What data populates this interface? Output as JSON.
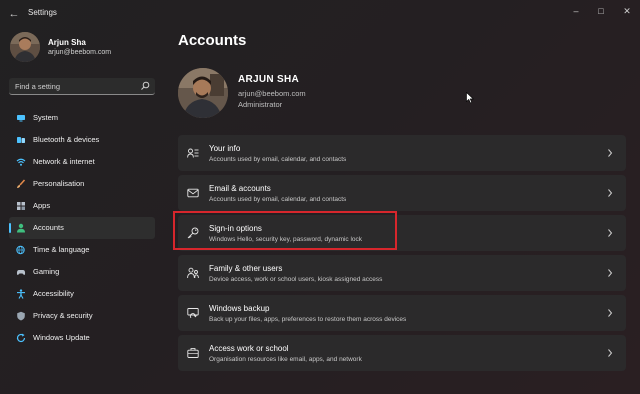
{
  "window": {
    "title": "Settings",
    "back_icon": "back-arrow-icon",
    "controls": [
      "minimize-icon",
      "maximize-icon",
      "close-icon"
    ]
  },
  "sidebar": {
    "profile": {
      "name": "Arjun Sha",
      "email": "arjun@beebom.com"
    },
    "search": {
      "placeholder": "Find a setting",
      "icon": "search-icon"
    },
    "items": [
      {
        "label": "System",
        "icon": "system-icon",
        "color": "#4cc2ff",
        "active": false
      },
      {
        "label": "Bluetooth & devices",
        "icon": "bluetooth-icon",
        "color": "#4cc2ff",
        "active": false
      },
      {
        "label": "Network & internet",
        "icon": "wifi-icon",
        "color": "#4cc2ff",
        "active": false
      },
      {
        "label": "Personalisation",
        "icon": "brush-icon",
        "color": "#e0884a",
        "active": false
      },
      {
        "label": "Apps",
        "icon": "apps-icon",
        "color": "#b8c1cc",
        "active": false
      },
      {
        "label": "Accounts",
        "icon": "accounts-icon",
        "color": "#3fbf7f",
        "active": true
      },
      {
        "label": "Time & language",
        "icon": "globe-clock-icon",
        "color": "#4cc2ff",
        "active": false
      },
      {
        "label": "Gaming",
        "icon": "gaming-icon",
        "color": "#b8c1cc",
        "active": false
      },
      {
        "label": "Accessibility",
        "icon": "accessibility-icon",
        "color": "#4cc2ff",
        "active": false
      },
      {
        "label": "Privacy & security",
        "icon": "shield-icon",
        "color": "#9aa6b2",
        "active": false
      },
      {
        "label": "Windows Update",
        "icon": "update-icon",
        "color": "#4cc2ff",
        "active": false
      }
    ]
  },
  "main": {
    "title": "Accounts",
    "user": {
      "name": "ARJUN SHA",
      "email": "arjun@beebom.com",
      "role": "Administrator"
    },
    "cards": [
      {
        "title": "Your info",
        "desc": "Accounts used by email, calendar, and contacts",
        "icon": "person-info-icon"
      },
      {
        "title": "Email & accounts",
        "desc": "Accounts used by email, calendar, and contacts",
        "icon": "mail-icon"
      },
      {
        "title": "Sign-in options",
        "desc": "Windows Hello, security key, password, dynamic lock",
        "icon": "key-icon"
      },
      {
        "title": "Family & other users",
        "desc": "Device access, work or school users, kiosk assigned access",
        "icon": "family-icon"
      },
      {
        "title": "Windows backup",
        "desc": "Back up your files, apps, preferences to restore them across devices",
        "icon": "backup-icon"
      },
      {
        "title": "Access work or school",
        "desc": "Organisation resources like email, apps, and network",
        "icon": "briefcase-icon"
      }
    ],
    "highlight_color": "#d7262c",
    "accent_color": "#4cc2ff"
  }
}
